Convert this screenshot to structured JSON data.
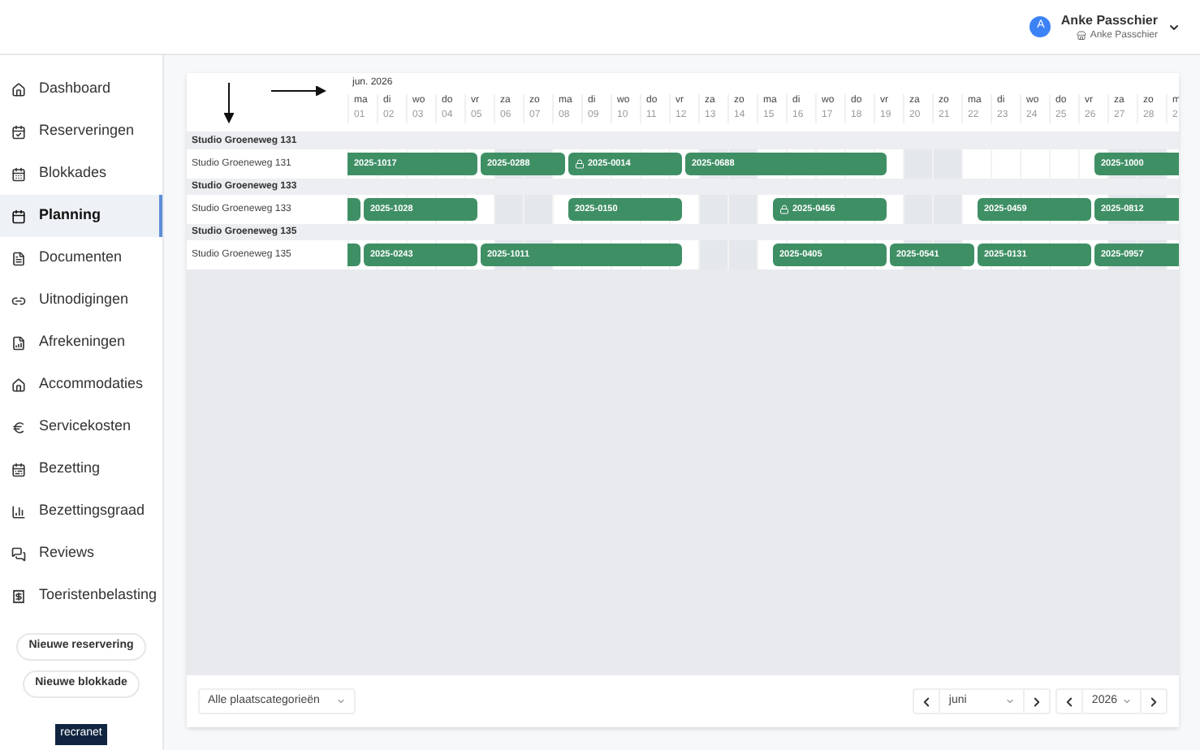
{
  "user": {
    "initial": "A",
    "name": "Anke Passchier",
    "account": "Anke Passchier"
  },
  "sidebar": {
    "items": [
      {
        "label": "Dashboard",
        "selected": false
      },
      {
        "label": "Reserveringen",
        "selected": false
      },
      {
        "label": "Blokkades",
        "selected": false
      },
      {
        "label": "Planning",
        "selected": true
      },
      {
        "label": "Documenten",
        "selected": false
      },
      {
        "label": "Uitnodigingen",
        "selected": false
      },
      {
        "label": "Afrekeningen",
        "selected": false
      },
      {
        "label": "Accommodaties",
        "selected": false
      },
      {
        "label": "Servicekosten",
        "selected": false
      },
      {
        "label": "Bezetting",
        "selected": false
      },
      {
        "label": "Bezettingsgraad",
        "selected": false
      },
      {
        "label": "Reviews",
        "selected": false
      },
      {
        "label": "Toeristenbelasting",
        "selected": false
      }
    ],
    "buttons": [
      "Nieuwe reservering",
      "Nieuwe blokkade"
    ],
    "logo": "recranet"
  },
  "planner": {
    "month": "jun. 2026",
    "days": [
      {
        "weekday": "ma",
        "date": "01",
        "weekend": false
      },
      {
        "weekday": "di",
        "date": "02",
        "weekend": false
      },
      {
        "weekday": "wo",
        "date": "03",
        "weekend": false
      },
      {
        "weekday": "do",
        "date": "04",
        "weekend": false
      },
      {
        "weekday": "vr",
        "date": "05",
        "weekend": false
      },
      {
        "weekday": "za",
        "date": "06",
        "weekend": true
      },
      {
        "weekday": "zo",
        "date": "07",
        "weekend": true
      },
      {
        "weekday": "ma",
        "date": "08",
        "weekend": false
      },
      {
        "weekday": "di",
        "date": "09",
        "weekend": false
      },
      {
        "weekday": "wo",
        "date": "10",
        "weekend": false
      },
      {
        "weekday": "do",
        "date": "11",
        "weekend": false
      },
      {
        "weekday": "vr",
        "date": "12",
        "weekend": false
      },
      {
        "weekday": "za",
        "date": "13",
        "weekend": true
      },
      {
        "weekday": "zo",
        "date": "14",
        "weekend": true
      },
      {
        "weekday": "ma",
        "date": "15",
        "weekend": false
      },
      {
        "weekday": "di",
        "date": "16",
        "weekend": false
      },
      {
        "weekday": "wo",
        "date": "17",
        "weekend": false
      },
      {
        "weekday": "do",
        "date": "18",
        "weekend": false
      },
      {
        "weekday": "vr",
        "date": "19",
        "weekend": false
      },
      {
        "weekday": "za",
        "date": "20",
        "weekend": true
      },
      {
        "weekday": "zo",
        "date": "21",
        "weekend": true
      },
      {
        "weekday": "ma",
        "date": "22",
        "weekend": false
      },
      {
        "weekday": "di",
        "date": "23",
        "weekend": false
      },
      {
        "weekday": "wo",
        "date": "24",
        "weekend": false
      },
      {
        "weekday": "do",
        "date": "25",
        "weekend": false
      },
      {
        "weekday": "vr",
        "date": "26",
        "weekend": false
      },
      {
        "weekday": "za",
        "date": "27",
        "weekend": true
      },
      {
        "weekday": "zo",
        "date": "28",
        "weekend": true
      },
      {
        "weekday": "m",
        "date": "2",
        "weekend": false,
        "cut": true
      }
    ],
    "groups": [
      {
        "name": "Studio Groeneweg 131",
        "unit": "Studio Groeneweg 131",
        "bookings": [
          {
            "label": "2025-1017",
            "locked": false
          },
          {
            "label": "2025-0288",
            "locked": false
          },
          {
            "label": "2025-0014",
            "locked": true
          },
          {
            "label": "2025-0688",
            "locked": false
          },
          {
            "label": "2025-1000",
            "locked": false
          }
        ]
      },
      {
        "name": "Studio Groeneweg 133",
        "unit": "Studio Groeneweg 133",
        "bookings": [
          {
            "locked": false
          },
          {
            "label": "2025-1028",
            "locked": false
          },
          {
            "label": "2025-0150",
            "locked": false
          },
          {
            "label": "2025-0456",
            "locked": true
          },
          {
            "label": "2025-0459",
            "locked": false
          },
          {
            "label": "2025-0812",
            "locked": false
          }
        ]
      },
      {
        "name": "Studio Groeneweg 135",
        "unit": "Studio Groeneweg 135",
        "bookings": [
          {
            "locked": false
          },
          {
            "label": "2025-0243",
            "locked": false
          },
          {
            "label": "2025-1011",
            "locked": false
          },
          {
            "label": "2025-0405",
            "locked": false
          },
          {
            "label": "2025-0541",
            "locked": false
          },
          {
            "label": "2025-0131",
            "locked": false
          },
          {
            "label": "2025-0957",
            "locked": false
          }
        ]
      }
    ]
  },
  "footer": {
    "category": "Alle plaatscategorieën",
    "month": "juni",
    "year": "2026"
  }
}
